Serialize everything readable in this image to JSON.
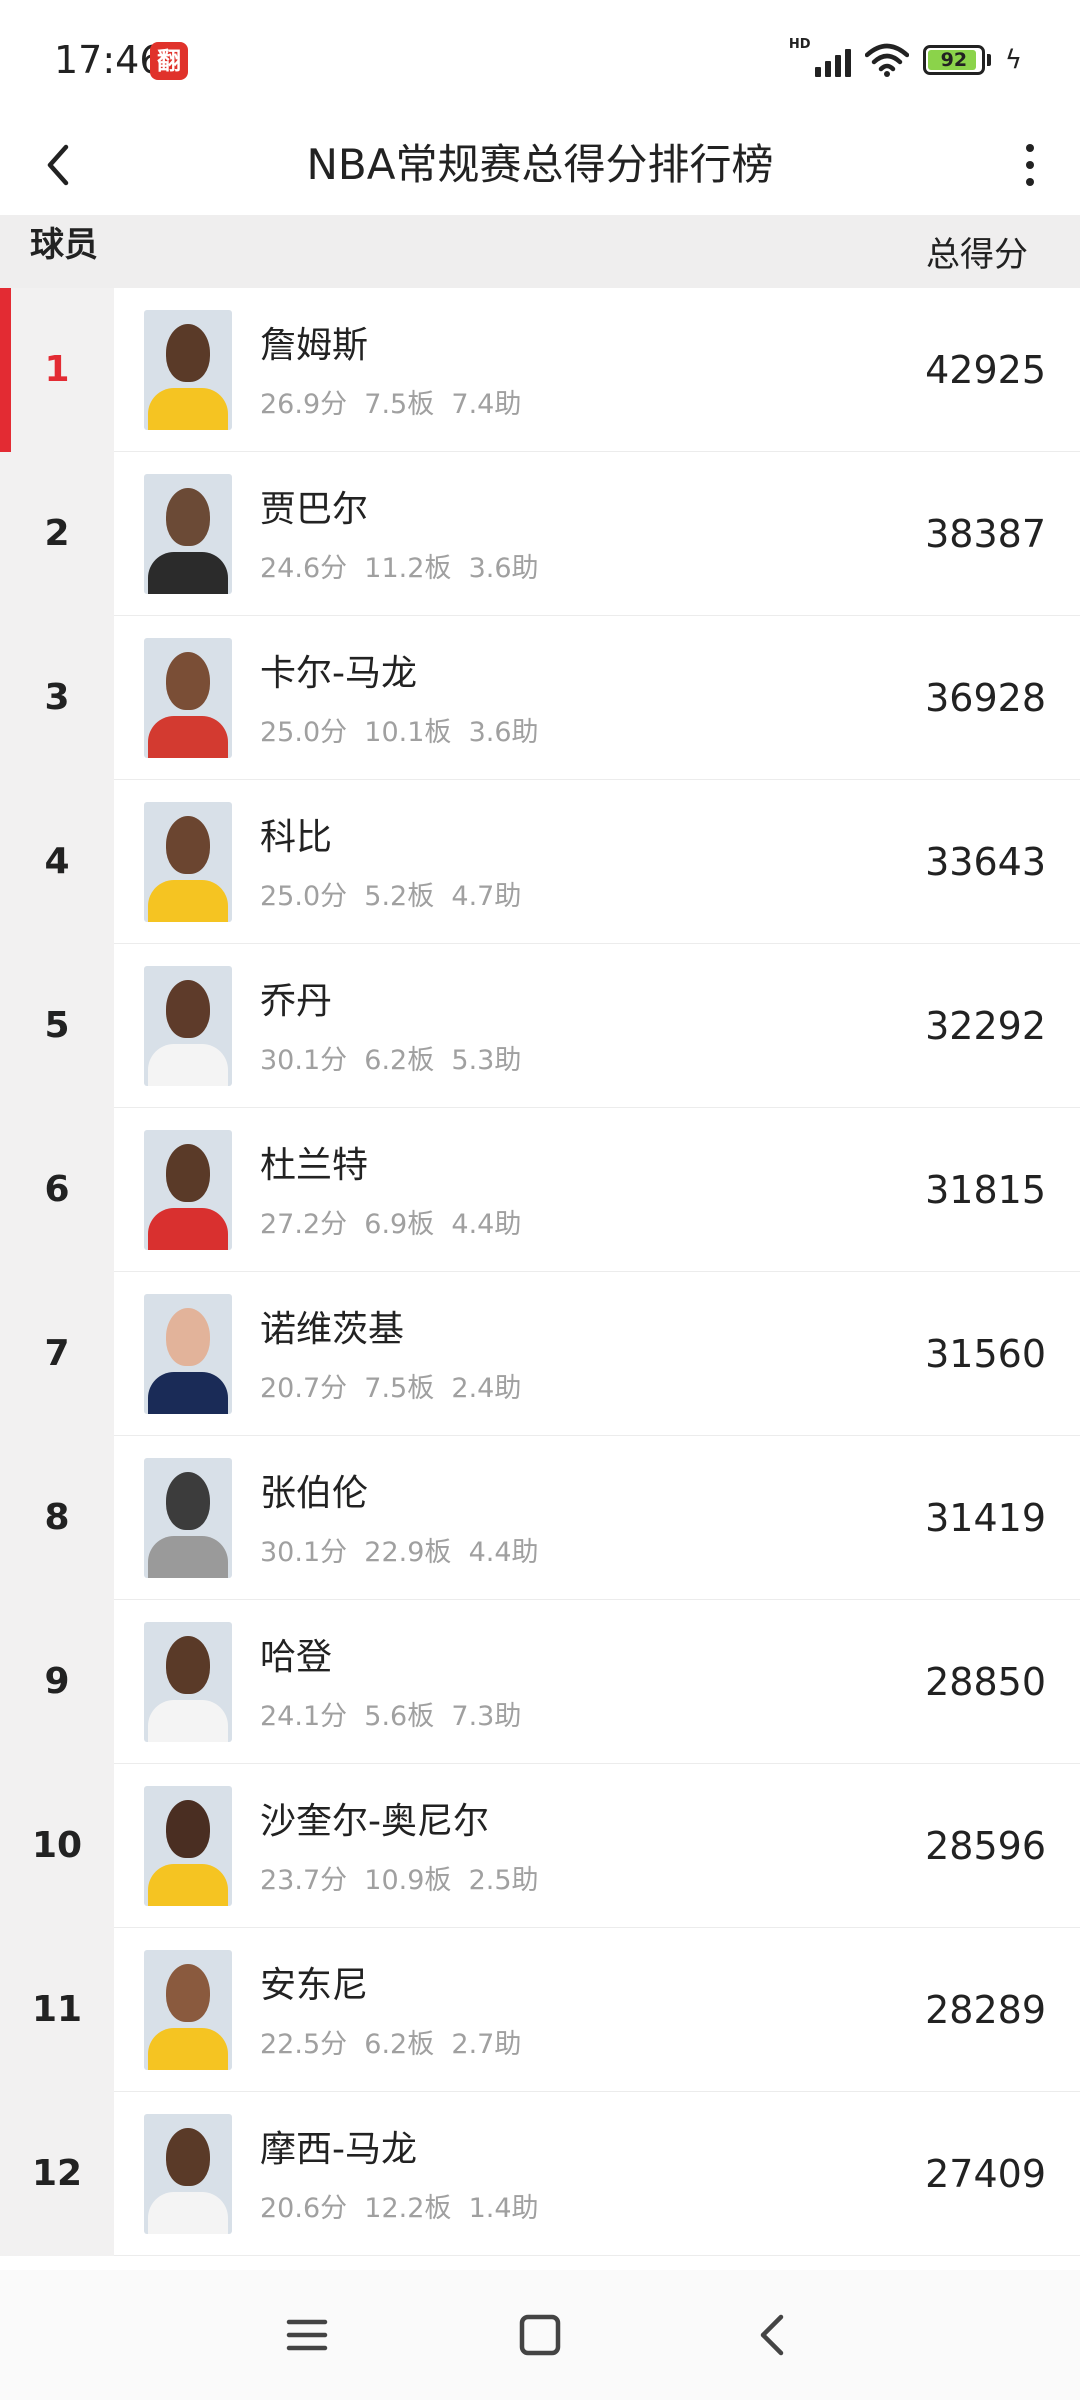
{
  "status": {
    "time": "17:46",
    "app_badge": "翻",
    "signal_label": "HD",
    "battery_level": "92"
  },
  "nav": {
    "title": "NBA常规赛总得分排行榜"
  },
  "header": {
    "player_col": "球员",
    "score_col": "总得分"
  },
  "colors": {
    "accent": "#e32b33",
    "rank_bg": "#f2f1f1",
    "header_bg": "#efeeee",
    "stats_text": "#a0a0a0"
  },
  "players": [
    {
      "rank": "1",
      "name": "詹姆斯",
      "stats": "26.9分  7.5板  7.4助",
      "score": "42925",
      "skin": "#5a3a28",
      "jersey": "#f5c422"
    },
    {
      "rank": "2",
      "name": "贾巴尔",
      "stats": "24.6分  11.2板  3.6助",
      "score": "38387",
      "skin": "#6b4a36",
      "jersey": "#2b2b2b"
    },
    {
      "rank": "3",
      "name": "卡尔-马龙",
      "stats": "25.0分  10.1板  3.6助",
      "score": "36928",
      "skin": "#7a4e36",
      "jersey": "#d33a30"
    },
    {
      "rank": "4",
      "name": "科比",
      "stats": "25.0分  5.2板  4.7助",
      "score": "33643",
      "skin": "#6b4530",
      "jersey": "#f5c422"
    },
    {
      "rank": "5",
      "name": "乔丹",
      "stats": "30.1分  6.2板  5.3助",
      "score": "32292",
      "skin": "#5e3b2a",
      "jersey": "#f4f4f4"
    },
    {
      "rank": "6",
      "name": "杜兰特",
      "stats": "27.2分  6.9板  4.4助",
      "score": "31815",
      "skin": "#5a3a28",
      "jersey": "#d9302f"
    },
    {
      "rank": "7",
      "name": "诺维茨基",
      "stats": "20.7分  7.5板  2.4助",
      "score": "31560",
      "skin": "#e2b39a",
      "jersey": "#1a2b57"
    },
    {
      "rank": "8",
      "name": "张伯伦",
      "stats": "30.1分  22.9板  4.4助",
      "score": "31419",
      "skin": "#3c3c3c",
      "jersey": "#9a9a9a"
    },
    {
      "rank": "9",
      "name": "哈登",
      "stats": "24.1分  5.6板  7.3助",
      "score": "28850",
      "skin": "#5a3a28",
      "jersey": "#f4f4f4"
    },
    {
      "rank": "10",
      "name": "沙奎尔-奥尼尔",
      "stats": "23.7分  10.9板  2.5助",
      "score": "28596",
      "skin": "#4a2e22",
      "jersey": "#f5c422"
    },
    {
      "rank": "11",
      "name": "安东尼",
      "stats": "22.5分  6.2板  2.7助",
      "score": "28289",
      "skin": "#8a5a3e",
      "jersey": "#f5c422"
    },
    {
      "rank": "12",
      "name": "摩西-马龙",
      "stats": "20.6分  12.2板  1.4助",
      "score": "27409",
      "skin": "#5a3a28",
      "jersey": "#f4f4f4"
    }
  ]
}
